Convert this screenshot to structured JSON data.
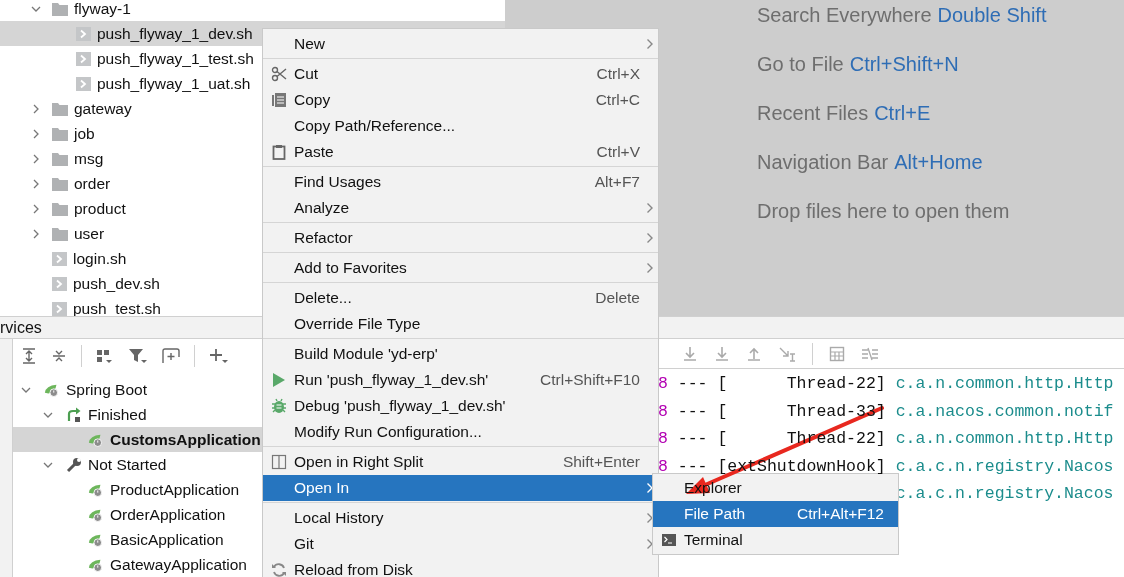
{
  "project_tree": [
    {
      "label": "flyway-1",
      "kind": "folder",
      "expanded": true,
      "selected": false,
      "children": [
        {
          "label": "push_flyway_1_dev.sh",
          "kind": "script",
          "selected": true
        },
        {
          "label": "push_flyway_1_test.sh",
          "kind": "script",
          "selected": false
        },
        {
          "label": "push_flyway_1_uat.sh",
          "kind": "script",
          "selected": false
        }
      ]
    },
    {
      "label": "gateway",
      "kind": "folder",
      "expanded": false,
      "selected": false
    },
    {
      "label": "job",
      "kind": "folder",
      "expanded": false,
      "selected": false
    },
    {
      "label": "msg",
      "kind": "folder",
      "expanded": false,
      "selected": false
    },
    {
      "label": "order",
      "kind": "folder",
      "expanded": false,
      "selected": false
    },
    {
      "label": "product",
      "kind": "folder",
      "expanded": false,
      "selected": false
    },
    {
      "label": "user",
      "kind": "folder",
      "expanded": false,
      "selected": false
    },
    {
      "label": "login.sh",
      "kind": "script",
      "selected": false
    },
    {
      "label": "push_dev.sh",
      "kind": "script",
      "selected": false
    },
    {
      "label": "push_test.sh",
      "kind": "script",
      "selected": false
    }
  ],
  "editor_hints": [
    {
      "label": "Search Everywhere",
      "shortcut": "Double Shift"
    },
    {
      "label": "Go to File",
      "shortcut": "Ctrl+Shift+N"
    },
    {
      "label": "Recent Files",
      "shortcut": "Ctrl+E"
    },
    {
      "label": "Navigation Bar",
      "shortcut": "Alt+Home"
    },
    {
      "label": "Drop files here to open them"
    }
  ],
  "services": {
    "title": "rvices",
    "tree": [
      {
        "label": "Spring Boot",
        "kind": "spring",
        "expanded": true,
        "selected": false,
        "children": [
          {
            "label": "Finished",
            "kind": "finished",
            "expanded": true,
            "selected": false,
            "children": [
              {
                "label": "CustomsApplication",
                "kind": "app",
                "selected": true
              }
            ]
          },
          {
            "label": "Not Started",
            "kind": "not_started",
            "expanded": true,
            "selected": false,
            "children": [
              {
                "label": "ProductApplication",
                "kind": "app",
                "selected": false
              },
              {
                "label": "OrderApplication",
                "kind": "app",
                "selected": false
              },
              {
                "label": "BasicApplication",
                "kind": "app",
                "selected": false
              },
              {
                "label": "GatewayApplication",
                "kind": "app",
                "selected": false
              }
            ]
          }
        ]
      }
    ]
  },
  "console": {
    "lines": [
      {
        "pid": "8",
        "thread": "--- [      Thread-22]",
        "logger": "c.a.n.common.http.Http"
      },
      {
        "pid": "8",
        "thread": "--- [      Thread-33]",
        "logger": "c.a.nacos.common.notif"
      },
      {
        "pid": "8",
        "thread": "--- [      Thread-22]",
        "logger": "c.a.n.common.http.Http"
      },
      {
        "pid": "8",
        "thread": "--- [extShutdownHook]",
        "logger": "c.a.c.n.registry.Nacos"
      },
      {
        "logger": "c.a.c.n.registry.Nacos"
      }
    ]
  },
  "context_menu": {
    "groups": [
      [
        {
          "label": "New",
          "submenu": true,
          "selected": false
        }
      ],
      [
        {
          "label": "Cut",
          "shortcut": "Ctrl+X",
          "submenu": false,
          "selected": false
        },
        {
          "label": "Copy",
          "shortcut": "Ctrl+C",
          "submenu": false,
          "selected": false
        },
        {
          "label": "Copy Path/Reference...",
          "submenu": false,
          "selected": false
        },
        {
          "label": "Paste",
          "shortcut": "Ctrl+V",
          "submenu": false,
          "selected": false
        }
      ],
      [
        {
          "label": "Find Usages",
          "shortcut": "Alt+F7",
          "submenu": false,
          "selected": false
        },
        {
          "label": "Analyze",
          "submenu": true,
          "selected": false
        }
      ],
      [
        {
          "label": "Refactor",
          "submenu": true,
          "selected": false
        }
      ],
      [
        {
          "label": "Add to Favorites",
          "submenu": true,
          "selected": false
        }
      ],
      [
        {
          "label": "Delete...",
          "shortcut": "Delete",
          "submenu": false,
          "selected": false
        },
        {
          "label": "Override File Type",
          "submenu": false,
          "selected": false
        }
      ],
      [
        {
          "label": "Build Module 'yd-erp'",
          "submenu": false,
          "selected": false
        },
        {
          "label": "Run 'push_flyway_1_dev.sh'",
          "shortcut": "Ctrl+Shift+F10",
          "submenu": false,
          "selected": false
        },
        {
          "label": "Debug 'push_flyway_1_dev.sh'",
          "submenu": false,
          "selected": false
        },
        {
          "label": "Modify Run Configuration...",
          "submenu": false,
          "selected": false
        }
      ],
      [
        {
          "label": "Open in Right Split",
          "shortcut": "Shift+Enter",
          "submenu": false,
          "selected": false
        },
        {
          "label": "Open In",
          "submenu": true,
          "selected": true
        }
      ],
      [
        {
          "label": "Local History",
          "submenu": true,
          "selected": false
        },
        {
          "label": "Git",
          "submenu": true,
          "selected": false
        },
        {
          "label": "Reload from Disk",
          "submenu": false,
          "selected": false
        }
      ]
    ]
  },
  "submenu": {
    "items": [
      {
        "label": "Explorer",
        "selected": false
      },
      {
        "label": "File Path",
        "shortcut": "Ctrl+Alt+F12",
        "selected": true
      },
      {
        "label": "Terminal",
        "selected": false
      }
    ]
  }
}
